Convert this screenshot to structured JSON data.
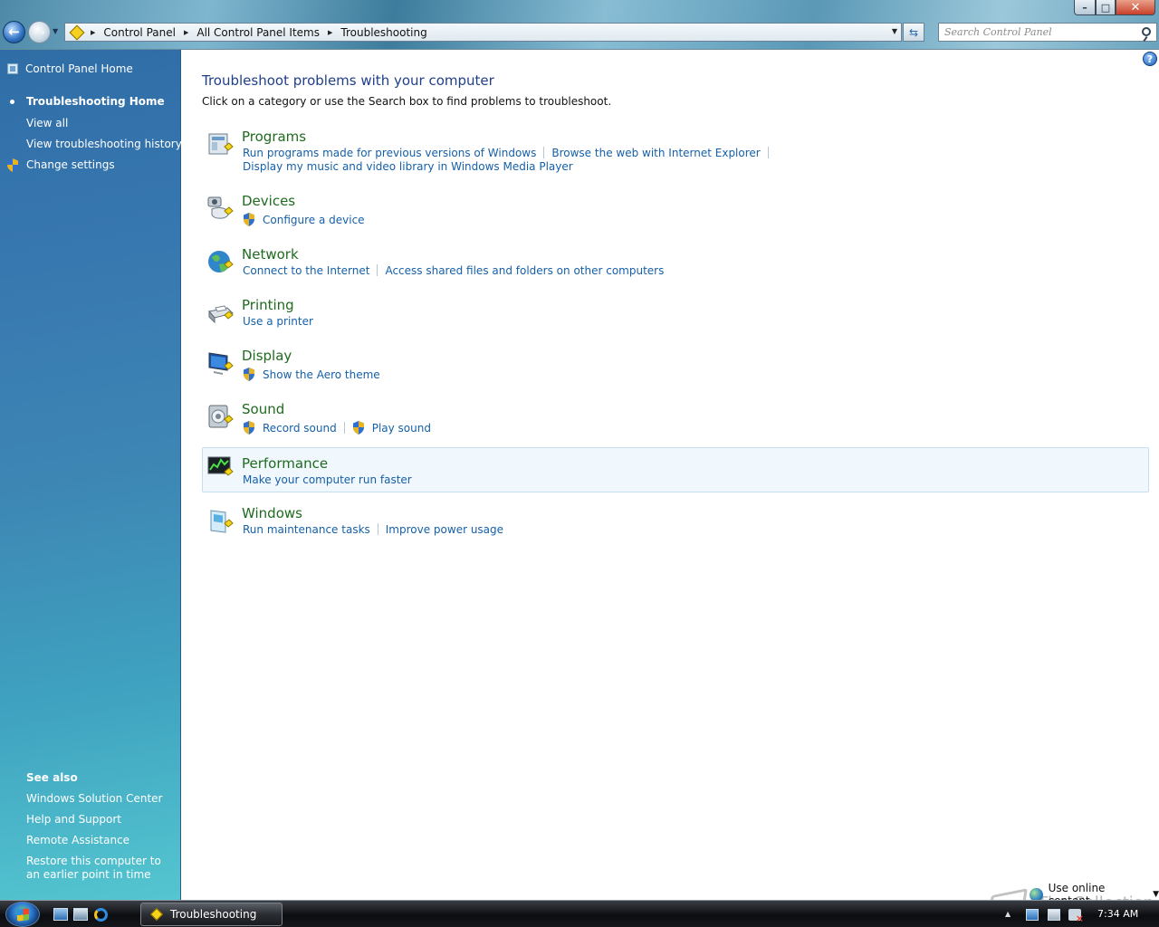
{
  "window": {
    "minimize_glyph": "–",
    "maximize_glyph": "□",
    "close_glyph": "✕"
  },
  "address_bar": {
    "breadcrumbs": [
      "Control Panel",
      "All Control Panel Items",
      "Troubleshooting"
    ],
    "search_placeholder": "Search Control Panel"
  },
  "sidebar": {
    "home_label": "Control Panel Home",
    "current_label": "Troubleshooting Home",
    "links": [
      "View all",
      "View troubleshooting history",
      "Change settings"
    ],
    "see_also_heading": "See also",
    "see_also": [
      "Windows Solution Center",
      "Help and Support",
      "Remote Assistance",
      "Restore this computer to an earlier point in time"
    ]
  },
  "main": {
    "title": "Troubleshoot problems with your computer",
    "subtitle": "Click on a category or use the Search box to find problems to troubleshoot.",
    "categories": [
      {
        "title": "Programs",
        "icon": "programs-icon",
        "links": [
          "Run programs made for previous versions of Windows",
          "Browse the web with Internet Explorer",
          "Display my music and video library in Windows Media Player"
        ]
      },
      {
        "title": "Devices",
        "icon": "devices-icon",
        "links": [
          "Configure a device"
        ]
      },
      {
        "title": "Network",
        "icon": "network-icon",
        "links": [
          "Connect to the Internet",
          "Access shared files and folders on other computers"
        ]
      },
      {
        "title": "Printing",
        "icon": "printer-icon",
        "links": [
          "Use a printer"
        ]
      },
      {
        "title": "Display",
        "icon": "display-icon",
        "links": [
          "Show the Aero theme"
        ]
      },
      {
        "title": "Sound",
        "icon": "sound-icon",
        "links": [
          "Record sound",
          "Play sound"
        ]
      },
      {
        "title": "Performance",
        "icon": "performance-icon",
        "links": [
          "Make your computer run faster"
        ]
      },
      {
        "title": "Windows",
        "icon": "windows-icon",
        "links": [
          "Run maintenance tasks",
          "Improve power usage"
        ]
      }
    ],
    "online_content_label": "Use online content",
    "watermark": "The Collection Book"
  },
  "taskbar": {
    "task_label": "Troubleshooting",
    "clock": "7:34 AM"
  },
  "colors": {
    "link": "#1560a8",
    "category_title": "#1e6b1e",
    "page_title": "#1f3f8a",
    "sidebar": "#3878b0"
  }
}
